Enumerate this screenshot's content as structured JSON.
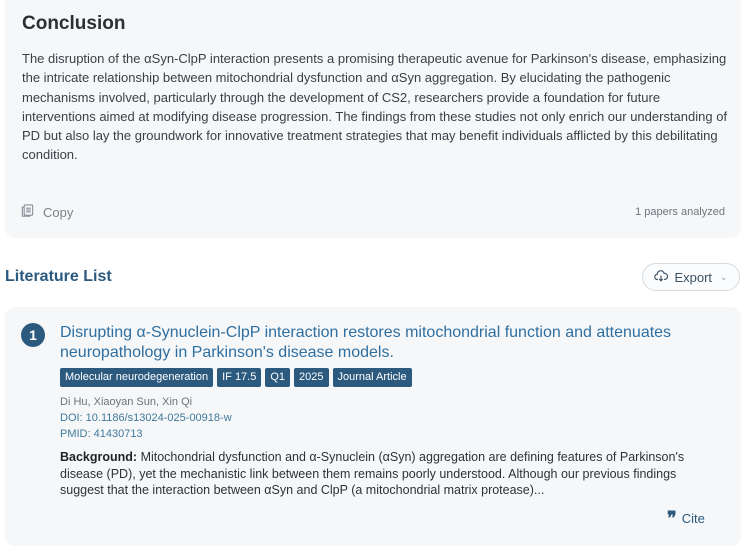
{
  "conclusion": {
    "title": "Conclusion",
    "body": "The disruption of the αSyn-ClpP interaction presents a promising therapeutic avenue for Parkinson's disease, emphasizing the intricate relationship between mitochondrial dysfunction and αSyn aggregation. By elucidating the pathogenic mechanisms involved, particularly through the development of CS2, researchers provide a foundation for future interventions aimed at modifying disease progression. The findings from these studies not only enrich our understanding of PD but also lay the groundwork for innovative treatment strategies that may benefit individuals afflicted by this debilitating condition.",
    "copy_label": "Copy",
    "papers_analyzed": "1 papers analyzed"
  },
  "literature": {
    "title": "Literature List",
    "export_label": "Export",
    "papers": [
      {
        "index": "1",
        "title": "Disrupting α-Synuclein-ClpP interaction restores mitochondrial function and attenuates neuropathology in Parkinson's disease models.",
        "tags": [
          "Molecular neurodegeneration",
          "IF 17.5",
          "Q1",
          "2025",
          "Journal Article"
        ],
        "authors": "Di Hu, Xiaoyan Sun, Xin Qi",
        "doi": "DOI: 10.1186/s13024-025-00918-w",
        "pmid": "PMID: 41430713",
        "abstract_label": "Background:",
        "abstract_text": " Mitochondrial dysfunction and α-Synuclein (αSyn) aggregation are defining features of Parkinson's disease (PD), yet the mechanistic link between them remains poorly understood. Although our previous findings suggest that the interaction between αSyn and ClpP (a mitochondrial matrix protease)...",
        "cite_label": "Cite"
      }
    ]
  },
  "colors": {
    "accent": "#2c5a7f",
    "link": "#2f6fa0",
    "card_bg": "#f6f7f9"
  },
  "icons": {
    "copy": "copy-icon",
    "export": "cloud-download-icon",
    "chevron": "chevron-down-icon",
    "cite": "quote-icon"
  }
}
